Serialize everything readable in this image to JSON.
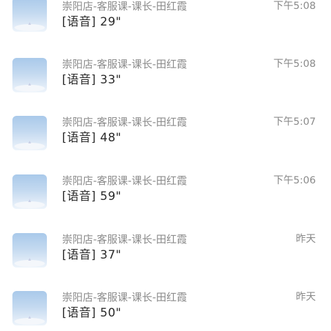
{
  "conversations": [
    {
      "name": "崇阳店-客服课-课长-田红霞",
      "time": "下午5:08",
      "preview": "[语音] 29\""
    },
    {
      "name": "崇阳店-客服课-课长-田红霞",
      "time": "下午5:08",
      "preview": "[语音] 33\""
    },
    {
      "name": "崇阳店-客服课-课长-田红霞",
      "time": "下午5:07",
      "preview": "[语音] 48\""
    },
    {
      "name": "崇阳店-客服课-课长-田红霞",
      "time": "下午5:06",
      "preview": "[语音] 59\""
    },
    {
      "name": "崇阳店-客服课-课长-田红霞",
      "time": "昨天",
      "preview": "[语音] 37\""
    },
    {
      "name": "崇阳店-客服课-课长-田红霞",
      "time": "昨天",
      "preview": "[语音] 50\""
    }
  ],
  "icons": {
    "avatar": "sky-avatar-icon"
  }
}
